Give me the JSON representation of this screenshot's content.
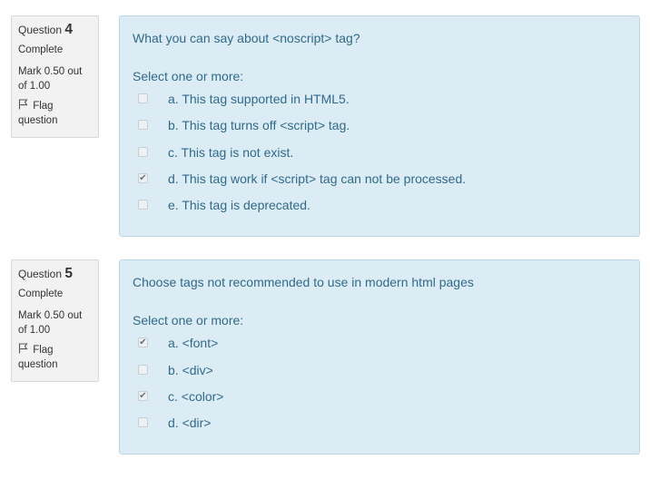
{
  "questions": [
    {
      "label": "Question",
      "number": "4",
      "state": "Complete",
      "grade": "Mark 0.50 out of 1.00",
      "flag": "Flag question",
      "text": "What you can say about <noscript> tag?",
      "prompt": "Select one or more:",
      "options": [
        {
          "label": "a. This tag supported in HTML5.",
          "checked": false
        },
        {
          "label": "b. This tag turns off <script> tag.",
          "checked": false
        },
        {
          "label": "c. This tag is not exist.",
          "checked": false
        },
        {
          "label": "d. This tag work if <script> tag can not be processed.",
          "checked": true
        },
        {
          "label": "e. This tag is deprecated.",
          "checked": false
        }
      ]
    },
    {
      "label": "Question",
      "number": "5",
      "state": "Complete",
      "grade": "Mark 0.50 out of 1.00",
      "flag": "Flag question",
      "text": "Choose tags not recommended to use in modern html pages",
      "prompt": "Select one or more:",
      "options": [
        {
          "label": "a. <font>",
          "checked": true
        },
        {
          "label": "b. <div>",
          "checked": false
        },
        {
          "label": "c. <color>",
          "checked": true
        },
        {
          "label": "d. <dir>",
          "checked": false
        }
      ]
    }
  ],
  "icons": {
    "flag": "flag-icon",
    "check": "checkmark-icon"
  }
}
